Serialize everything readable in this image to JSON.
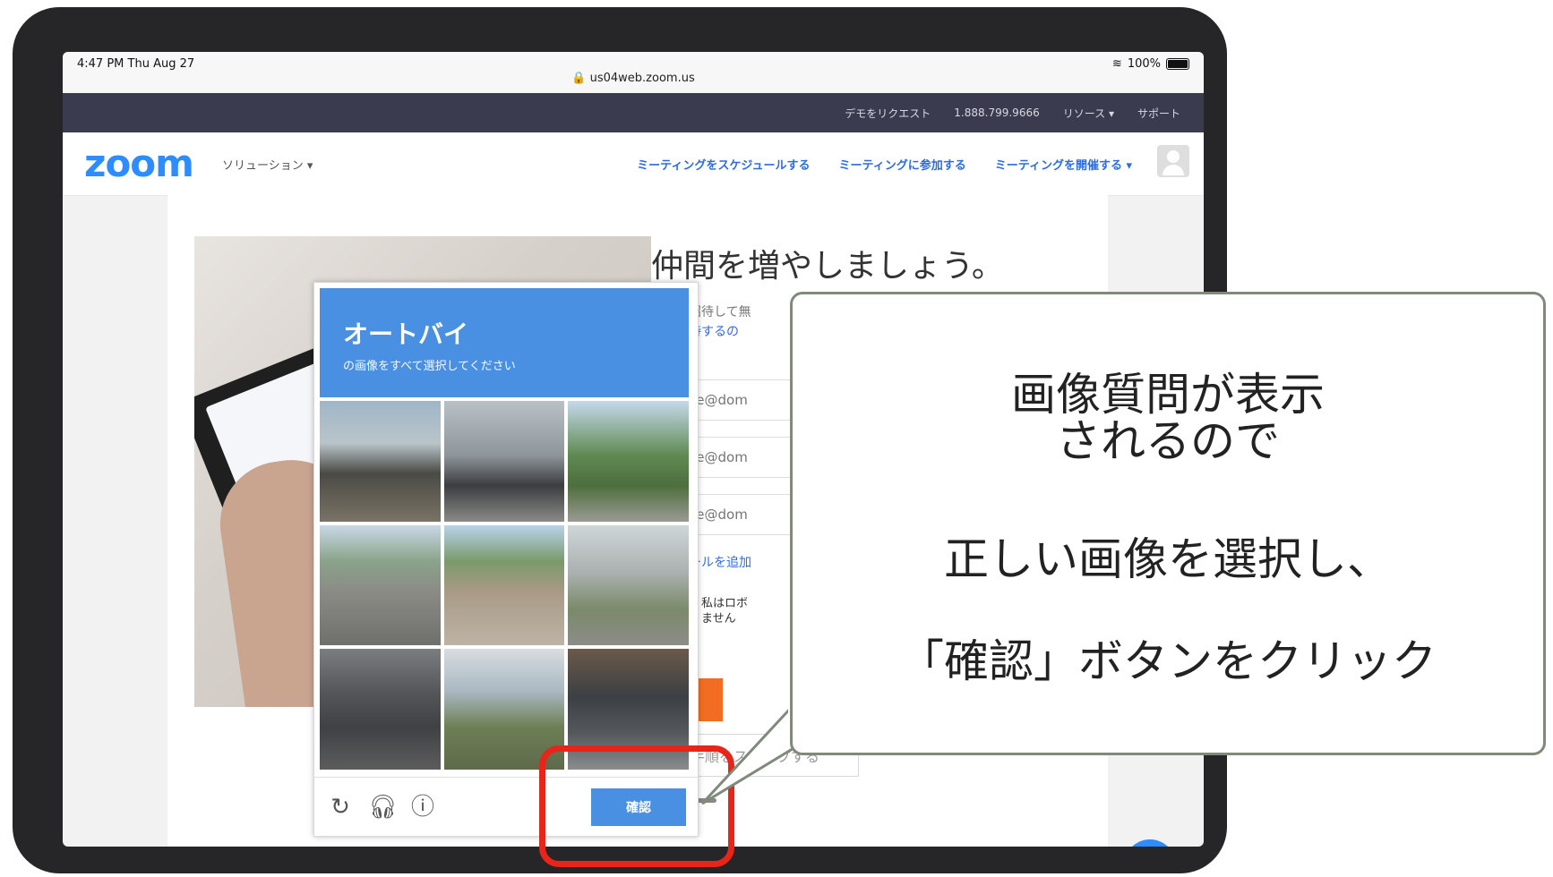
{
  "status_bar": {
    "time": "4:47 PM   Thu Aug 27",
    "url": "us04web.zoom.us",
    "battery": "100%"
  },
  "top_bar": {
    "items": [
      "デモをリクエスト",
      "1.888.799.9666",
      "リソース ▾",
      "サポート"
    ]
  },
  "nav": {
    "logo": "zoom",
    "solutions": "ソリューション ▾",
    "links": [
      "ミーティングをスケジュールする",
      "ミーティングに参加する",
      "ミーティングを開催する ▾"
    ]
  },
  "page": {
    "title": "仲間を増やしましょう。",
    "desc_partial": "仲間を招待して無",
    "why_link": "なぜ招待するの",
    "email_placeholders": [
      "name@dom",
      "name@dom",
      "name@dom"
    ],
    "add_email": "別のメールを追加",
    "robot_checkbox_label_line1": "私はロボ",
    "robot_checkbox_label_line2": "ません",
    "skip_button": "手順をスキップする"
  },
  "captcha": {
    "title": "オートバイ",
    "subtitle": "の画像をすべて選択してください",
    "verify_button": "確認",
    "icons": [
      "refresh-icon",
      "headphones-icon",
      "info-icon"
    ]
  },
  "callout": {
    "line1": "画像質問が表示",
    "line2": "されるので",
    "line3": "正しい画像を選択し、",
    "line4": "「確認」ボタンをクリック"
  },
  "colors": {
    "zoom_blue": "#2d8cff",
    "captcha_blue": "#4a90e2",
    "highlight_red": "#e8251b",
    "topbar": "#3b3b4f"
  }
}
